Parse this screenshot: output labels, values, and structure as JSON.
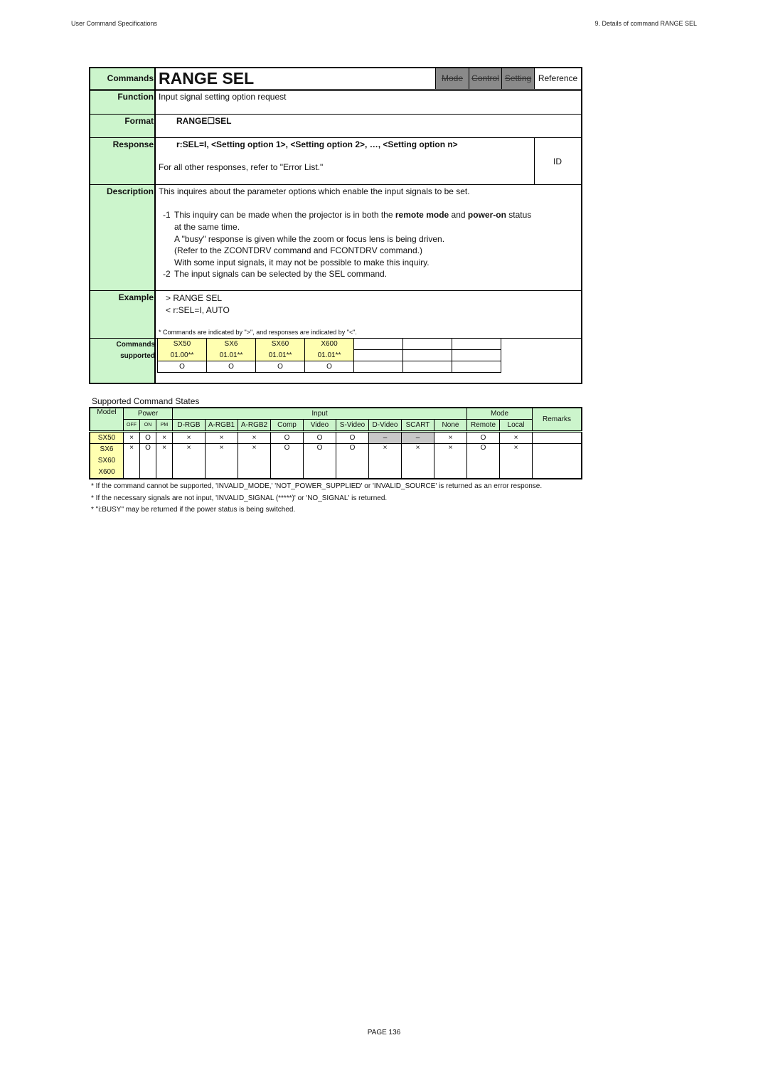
{
  "header": {
    "left": "User Command Specifications",
    "right": "9. Details of command  RANGE SEL"
  },
  "spec": {
    "commands_label": "Commands",
    "command_name": "RANGE SEL",
    "tags": [
      {
        "label": "Mode",
        "enabled": false
      },
      {
        "label": "Control",
        "enabled": false
      },
      {
        "label": "Setting",
        "enabled": false
      },
      {
        "label": "Reference",
        "enabled": true
      }
    ],
    "function_label": "Function",
    "function_text": "Input signal setting option request",
    "format_label": "Format",
    "format_text": "RANGE☐SEL",
    "response_label": "Response",
    "response_text": "r:SEL=I, <Setting option 1>, <Setting option 2>, …, <Setting option n>",
    "response_other": "For all other responses, refer to \"Error List.\"",
    "response_id": "ID",
    "description_label": "Description",
    "description_main": "This inquires about the parameter options which enable the input signals to be set.",
    "note1_num": "-1",
    "note1_pre": "This inquiry can be made when the projector is in both the ",
    "note1_b1": "remote mode",
    "note1_mid": " and ",
    "note1_b2": "power-on",
    "note1_post": " status",
    "note1_lines": [
      "at the same time.",
      "A \"busy\" response is given while the zoom or focus lens is being driven.",
      "(Refer to the ZCONTDRV command and FCONTDRV command.)",
      "With some input signals, it may not be possible to make this inquiry."
    ],
    "note2_num": "-2",
    "note2_text": "The input signals can be selected by the SEL command.",
    "example_label": "Example",
    "example_lines": [
      "> RANGE SEL",
      "< r:SEL=I, AUTO"
    ],
    "example_note": "* Commands are indicated by \">\", and responses are indicated by \"<\".",
    "supported_label_1": "Commands",
    "supported_label_2": "supported",
    "supported_models": [
      {
        "model": "SX50",
        "version": "01.00**",
        "mark": "O"
      },
      {
        "model": "SX6",
        "version": "01.01**",
        "mark": "O"
      },
      {
        "model": "SX60",
        "version": "01.01**",
        "mark": "O"
      },
      {
        "model": "X600",
        "version": "01.01**",
        "mark": "O"
      }
    ]
  },
  "states": {
    "title": "Supported Command States",
    "headers": {
      "model": "Model",
      "power": "Power",
      "input": "Input",
      "mode": "Mode",
      "remarks": "Remarks",
      "power_cols": [
        "OFF",
        "ON",
        "PM"
      ],
      "input_cols": [
        "D-RGB",
        "A-RGB1",
        "A-RGB2",
        "Comp",
        "Video",
        "S-Video",
        "D-Video",
        "SCART",
        "None"
      ],
      "mode_cols": [
        "Remote",
        "Local"
      ]
    },
    "rows": [
      {
        "models": [
          "SX50"
        ],
        "values": [
          "×",
          "O",
          "×",
          "×",
          "×",
          "×",
          "O",
          "O",
          "O",
          "–",
          "–",
          "×",
          "O",
          "×"
        ],
        "remarks": ""
      },
      {
        "models": [
          "SX6",
          "SX60",
          "X600"
        ],
        "values": [
          "×",
          "O",
          "×",
          "×",
          "×",
          "×",
          "O",
          "O",
          "O",
          "×",
          "×",
          "×",
          "O",
          "×"
        ],
        "remarks": ""
      }
    ]
  },
  "notes": [
    "* If the command cannot be supported, 'INVALID_MODE,' 'NOT_POWER_SUPPLIED' or 'INVALID_SOURCE' is returned as an error response.",
    "* If the necessary signals are not input, 'INVALID_SIGNAL (*****)' or 'NO_SIGNAL' is returned.",
    "* \"i:BUSY\" may be returned if the power status is being switched."
  ],
  "footer": {
    "page": "PAGE 136"
  }
}
